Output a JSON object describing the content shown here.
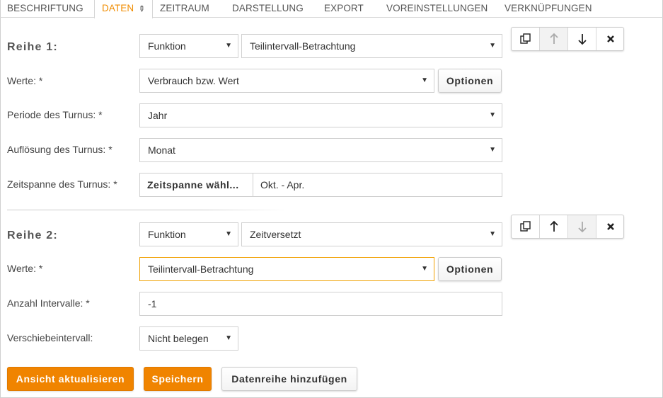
{
  "tabs": [
    {
      "label": "BESCHRIFTUNG"
    },
    {
      "label": "DATEN"
    },
    {
      "label": "ZEITRAUM"
    },
    {
      "label": "DARSTELLUNG"
    },
    {
      "label": "EXPORT"
    },
    {
      "label": "VOREINSTELLUNGEN"
    },
    {
      "label": "VERKNÜPFUNGEN"
    }
  ],
  "accent_color": "#f08400",
  "series1": {
    "title": "Reihe 1:",
    "type_select": "Funktion",
    "function_select": "Teilintervall-Betrachtung",
    "werte_label": "Werte: *",
    "werte_value": "Verbrauch bzw. Wert",
    "options_label": "Optionen",
    "periode_label": "Periode des Turnus: *",
    "periode_value": "Jahr",
    "aufloesung_label": "Auflösung des Turnus: *",
    "aufloesung_value": "Monat",
    "zeitspanne_label": "Zeitspanne des Turnus: *",
    "zeitspanne_button": "Zeitspanne wähl...",
    "zeitspanne_value": "Okt. - Apr."
  },
  "series2": {
    "title": "Reihe 2:",
    "type_select": "Funktion",
    "function_select": "Zeitversetzt",
    "werte_label": "Werte: *",
    "werte_value": "Teilintervall-Betrachtung",
    "options_label": "Optionen",
    "anzahl_label": "Anzahl Intervalle: *",
    "anzahl_value": "-1",
    "verschiebe_label": "Verschiebeintervall:",
    "verschiebe_value": "Nicht belegen"
  },
  "footer": {
    "update_label": "Ansicht aktualisieren",
    "save_label": "Speichern",
    "add_label": "Datenreihe hinzufügen"
  }
}
